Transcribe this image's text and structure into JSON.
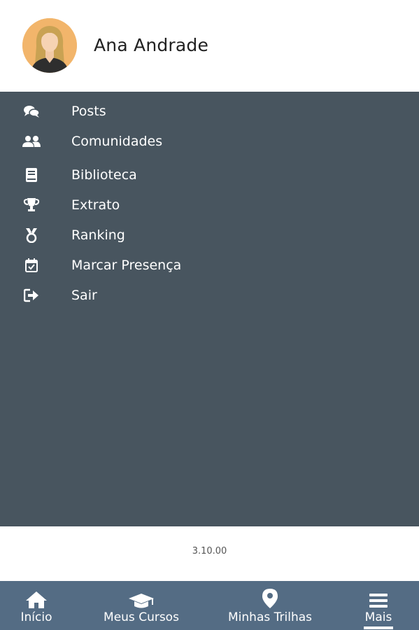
{
  "profile": {
    "name": "Ana Andrade",
    "avatar_bg": "#f2b56b"
  },
  "menu": {
    "bg_color": "#48555f",
    "items": [
      {
        "label": "Posts",
        "icon": "comments-icon"
      },
      {
        "label": "Comunidades",
        "icon": "users-icon"
      },
      {
        "label": "Biblioteca",
        "icon": "book-icon"
      },
      {
        "label": "Extrato",
        "icon": "trophy-icon"
      },
      {
        "label": "Ranking",
        "icon": "medal-icon"
      },
      {
        "label": "Marcar Presença",
        "icon": "calendar-check-icon"
      },
      {
        "label": "Sair",
        "icon": "sign-out-icon"
      }
    ]
  },
  "version": "3.10.00",
  "bottom_nav": {
    "bg_color": "#546c84",
    "items": [
      {
        "label": "Início",
        "icon": "home-icon"
      },
      {
        "label": "Meus Cursos",
        "icon": "graduation-cap-icon"
      },
      {
        "label": "Minhas Trilhas",
        "icon": "map-marker-icon"
      },
      {
        "label": "Mais",
        "icon": "menu-icon",
        "active": true
      }
    ]
  }
}
